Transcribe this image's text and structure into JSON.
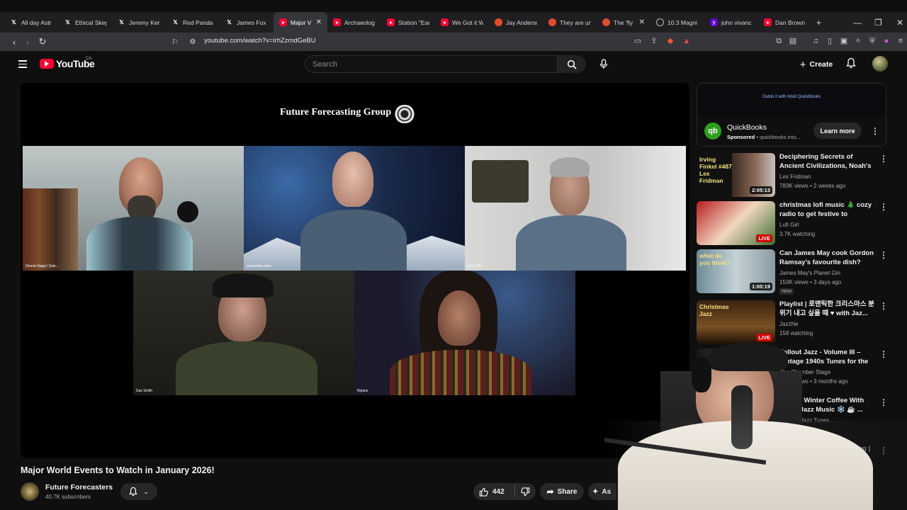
{
  "browser": {
    "tabs": [
      {
        "label": "All day Astr",
        "fav": "x"
      },
      {
        "label": "Ethical Skep",
        "fav": "x"
      },
      {
        "label": "Jeremy Ken",
        "fav": "x"
      },
      {
        "label": "Red Panda",
        "fav": "x"
      },
      {
        "label": "James Fox c",
        "fav": "x"
      },
      {
        "label": "Major V",
        "fav": "yt",
        "active": true
      },
      {
        "label": "Archaeolog",
        "fav": "yt"
      },
      {
        "label": "Station \"Ear",
        "fav": "yt"
      },
      {
        "label": "We Got it W",
        "fav": "yt"
      },
      {
        "label": "Jay Anderso",
        "fav": "br"
      },
      {
        "label": "They are un",
        "fav": "br"
      },
      {
        "label": "The 'fly",
        "fav": "br"
      },
      {
        "label": "10.3 Magni",
        "fav": "gl"
      },
      {
        "label": "john vivanc",
        "fav": "yh"
      },
      {
        "label": "Dan Brown",
        "fav": "yt"
      }
    ],
    "url": "youtube.com/watch?v=irhZzmdGeBU"
  },
  "youtube": {
    "logo_text": "YouTube",
    "country_code": "CA",
    "search_placeholder": "Search",
    "create_label": "Create"
  },
  "video": {
    "overlay_title": "Future Forecasting Group",
    "participants": [
      "Dennis Napp l Solo...",
      "edwarddourdan",
      "FFG HQ",
      "Daz Smith",
      "Nylans"
    ],
    "title": "Major World Events to Watch in January 2026!",
    "channel": "Future Forecasters",
    "subscribers": "40.7K subscribers",
    "likes": "442",
    "share_label": "Share",
    "more_label": "As"
  },
  "ad": {
    "banner_text": "Outdo it with Intuit QuickBooks",
    "name": "QuickBooks",
    "sponsored": "Sponsored",
    "domain": "quickbooks.intu...",
    "cta": "Learn more"
  },
  "recommendations": [
    {
      "title": "Deciphering Secrets of Ancient Civilizations, Noah's Ark, and ...",
      "channel": "Lex Fridman",
      "meta": "783K views • 2 weeks ago",
      "badge": "2:05:13",
      "live": false,
      "thumb_text": "Irving Finkel #487 Lex Fridman"
    },
    {
      "title": "christmas lofi music 🎄 cozy radio to get festive to",
      "channel": "Lofi Girl",
      "meta": "3.7K watching",
      "badge": "LIVE",
      "live": true
    },
    {
      "title": "Can James May cook Gordon Ramsay's favourite dish?",
      "channel": "James May's Planet Gin",
      "meta": "153K views • 3 days ago",
      "badge": "1:00:19",
      "live": false,
      "new": "New",
      "thumb_text": "what do you think?"
    },
    {
      "title": "Playlist | 로맨틱한 크리스마스 분위기 내고 싶을 때 ♥ with Jaz...",
      "channel": "JazzNe",
      "meta": "158 watching",
      "badge": "LIVE",
      "live": true,
      "thumb_text": "Christmas Jazz"
    },
    {
      "title": "Fallout Jazz - Volume III – Vintage 1940s Tunes for the ...",
      "channel": "The Chamber Stage",
      "meta": "109K views • 3 months ago",
      "badge": "",
      "live": false
    },
    {
      "title": "A Cozy Winter Coffee With Warm Jazz Music ❄️ ☕ ...",
      "channel": "Smooth Jazz Tunes",
      "meta": "76 watching",
      "badge": "",
      "live": false
    },
    {
      "title": "...l Music For A Cozy ...ping | A Fairytale ...",
      "channel": "",
      "meta": "",
      "badge": "",
      "live": false
    }
  ],
  "colors": {
    "accent": "#ff0033",
    "background": "#0f0f0f",
    "chip": "#272727",
    "live": "#cc0000"
  }
}
